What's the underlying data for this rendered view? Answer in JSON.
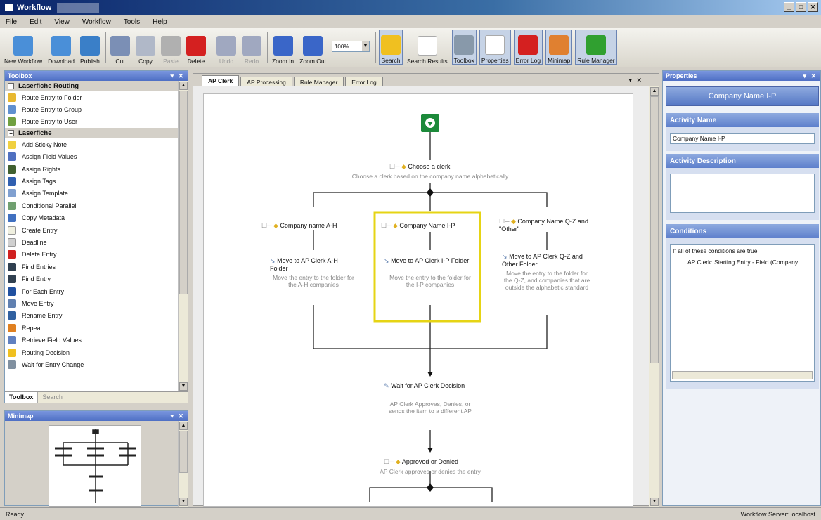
{
  "window": {
    "title": "Workflow",
    "controls": [
      "_",
      "□",
      "✕"
    ]
  },
  "menu": [
    "File",
    "Edit",
    "View",
    "Workflow",
    "Tools",
    "Help"
  ],
  "toolbar": {
    "buttons": [
      {
        "label": "New Workflow",
        "icon": "new-workflow-icon",
        "color": "#4a8fd8"
      },
      {
        "label": "Download",
        "icon": "download-icon",
        "color": "#4a8fd8"
      },
      {
        "label": "Publish",
        "icon": "publish-icon",
        "color": "#3a7fc8"
      },
      {
        "label": "Cut",
        "icon": "cut-icon",
        "color": "#7b8fb5"
      },
      {
        "label": "Copy",
        "icon": "copy-icon",
        "color": "#b0b8c8"
      },
      {
        "label": "Paste",
        "icon": "paste-icon",
        "color": "#b0b0b0",
        "disabled": true
      },
      {
        "label": "Delete",
        "icon": "delete-icon",
        "color": "#d42020"
      },
      {
        "label": "Undo",
        "icon": "undo-icon",
        "color": "#a0a8c0",
        "disabled": true
      },
      {
        "label": "Redo",
        "icon": "redo-icon",
        "color": "#a0a8c0",
        "disabled": true
      },
      {
        "label": "Zoom In",
        "icon": "zoom-in-icon",
        "color": "#3a66c8"
      },
      {
        "label": "Zoom Out",
        "icon": "zoom-out-icon",
        "color": "#3a66c8"
      }
    ],
    "zoom": "100%",
    "buttons2": [
      {
        "label": "Search",
        "icon": "search-icon",
        "color": "#f0c020",
        "toggled": true
      },
      {
        "label": "Search Results",
        "icon": "search-results-icon",
        "color": "#ffffff",
        "toggled": false
      },
      {
        "label": "Toolbox",
        "icon": "toolbox-icon",
        "color": "#8899aa",
        "toggled": true
      },
      {
        "label": "Properties",
        "icon": "properties-icon",
        "color": "#ffffff",
        "toggled": true
      },
      {
        "label": "Error Log",
        "icon": "error-log-icon",
        "color": "#d42020",
        "toggled": true
      },
      {
        "label": "Minimap",
        "icon": "minimap-icon",
        "color": "#e08030",
        "toggled": true
      },
      {
        "label": "Rule Manager",
        "icon": "rule-manager-icon",
        "color": "#30a030",
        "toggled": true
      }
    ]
  },
  "toolbox": {
    "title": "Toolbox",
    "categories": [
      {
        "name": "Laserfiche Routing",
        "items": [
          {
            "label": "Route Entry to Folder",
            "color": "#e8b830"
          },
          {
            "label": "Route Entry to Group",
            "color": "#6090d0"
          },
          {
            "label": "Route Entry to User",
            "color": "#70a040"
          }
        ]
      },
      {
        "name": "Laserfiche",
        "items": [
          {
            "label": "Add Sticky Note",
            "color": "#f0d040"
          },
          {
            "label": "Assign Field Values",
            "color": "#5070c0"
          },
          {
            "label": "Assign Rights",
            "color": "#406030"
          },
          {
            "label": "Assign Tags",
            "color": "#3060b0"
          },
          {
            "label": "Assign Template",
            "color": "#80a0d0"
          },
          {
            "label": "Conditional Parallel",
            "color": "#70a070"
          },
          {
            "label": "Copy Metadata",
            "color": "#4070c0"
          },
          {
            "label": "Create Entry",
            "color": "#f0f0e0"
          },
          {
            "label": "Deadline",
            "color": "#d0d0d0"
          },
          {
            "label": "Delete Entry",
            "color": "#d02020"
          },
          {
            "label": "Find Entries",
            "color": "#304050"
          },
          {
            "label": "Find Entry",
            "color": "#304050"
          },
          {
            "label": "For Each Entry",
            "color": "#2050a0"
          },
          {
            "label": "Move Entry",
            "color": "#6080b0"
          },
          {
            "label": "Rename Entry",
            "color": "#3060a0"
          },
          {
            "label": "Repeat",
            "color": "#e08020"
          },
          {
            "label": "Retrieve Field Values",
            "color": "#6080c0"
          },
          {
            "label": "Routing Decision",
            "color": "#f0c020"
          },
          {
            "label": "Wait for Entry Change",
            "color": "#8090a0"
          }
        ]
      }
    ],
    "tabs": [
      "Toolbox",
      "Search"
    ]
  },
  "minimap": {
    "title": "Minimap"
  },
  "designer": {
    "tabs": [
      "AP Clerk",
      "AP Processing",
      "Rule Manager",
      "Error Log"
    ],
    "nodes": {
      "choose": {
        "title": "Choose a clerk",
        "desc": "Choose a clerk based on the company name alphabetically"
      },
      "branch_a": {
        "title": "Company name A-H"
      },
      "branch_b": {
        "title": "Company Name I-P"
      },
      "branch_c": {
        "title": "Company Name Q-Z and \"Other\""
      },
      "move_a": {
        "title": "Move to AP Clerk A-H Folder",
        "desc": "Move the entry to the folder for the A-H companies"
      },
      "move_b": {
        "title": "Move to AP Clerk I-P Folder",
        "desc": "Move the entry to the folder for the I-P companies"
      },
      "move_c": {
        "title": "Move to AP Clerk Q-Z and Other Folder",
        "desc": "Move the entry to the folder for the Q-Z, and companies that are outside the alphabetic standard"
      },
      "wait": {
        "title": "Wait for AP Clerk Decision",
        "desc": "AP Clerk Approves, Denies, or sends the item to a different AP"
      },
      "approved": {
        "title": "Approved or Denied",
        "desc": "AP Clerk approves or denies the entry"
      }
    }
  },
  "properties": {
    "title": "Properties",
    "name_bar": "Company Name I-P",
    "activity_name_label": "Activity Name",
    "activity_name_value": "Company Name I-P",
    "activity_description_label": "Activity Description",
    "conditions_label": "Conditions",
    "conditions_header": "If all of these conditions are true",
    "condition_row": "AP Clerk: Starting Entry - Field (Company"
  },
  "status": {
    "left": "Ready",
    "right": "Workflow Server: localhost"
  }
}
